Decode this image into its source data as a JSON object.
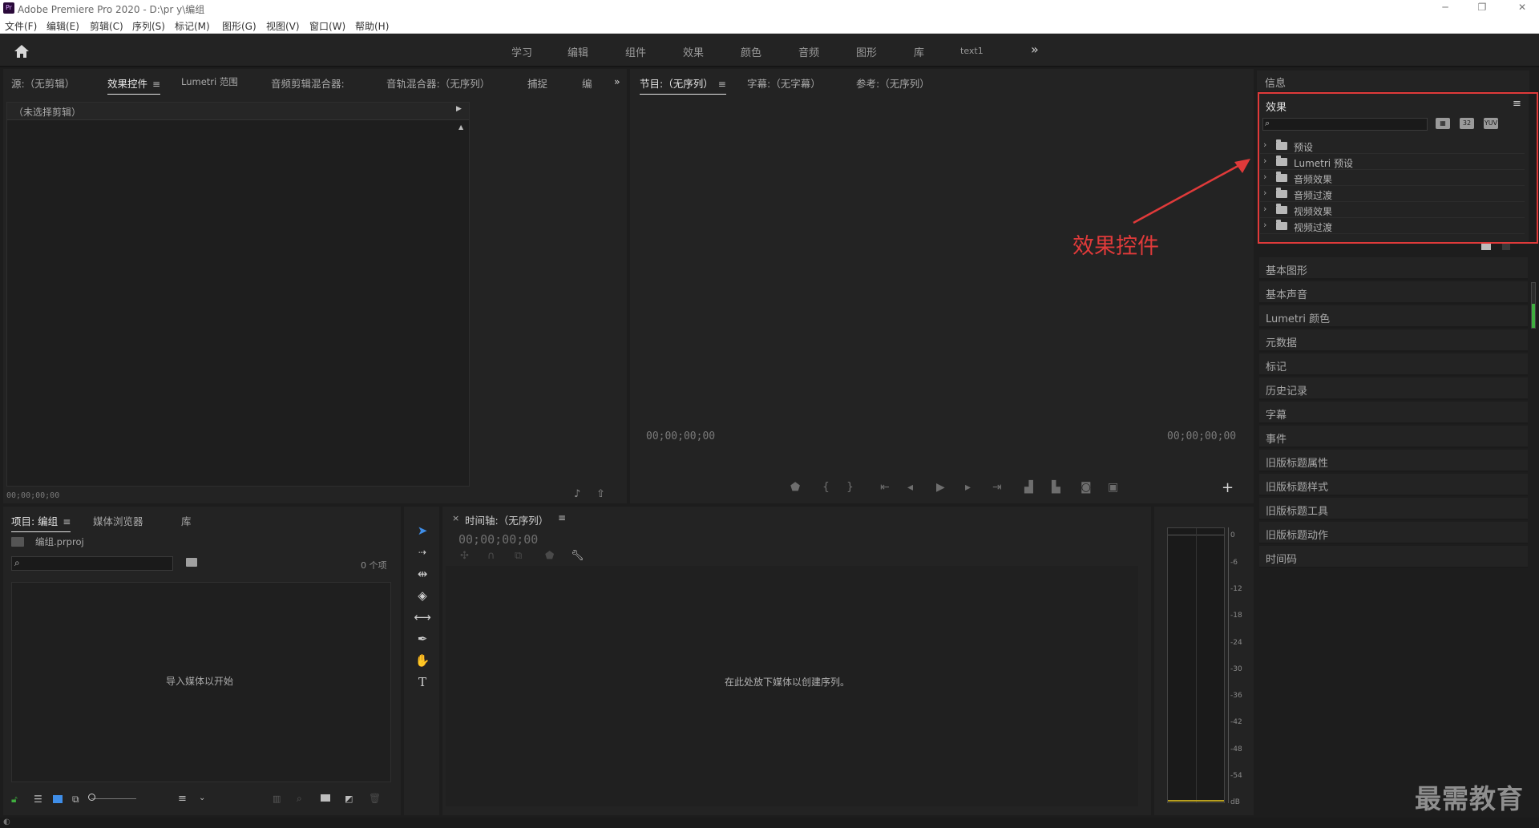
{
  "app": {
    "title": "Adobe Premiere Pro 2020 - D:\\pr y\\编组",
    "logo": "Pr"
  },
  "window_controls": {
    "minimize": "─",
    "restore": "❐",
    "close": "✕"
  },
  "menu": [
    "文件(F)",
    "编辑(E)",
    "剪辑(C)",
    "序列(S)",
    "标记(M)",
    "图形(G)",
    "视图(V)",
    "窗口(W)",
    "帮助(H)"
  ],
  "workspaces": [
    "学习",
    "编辑",
    "组件",
    "效果",
    "颜色",
    "音频",
    "图形",
    "库",
    "text1"
  ],
  "workspace_more": "»",
  "source_panel": {
    "tabs": [
      "源:（无剪辑）",
      "效果控件",
      "Lumetri 范围",
      "音频剪辑混合器:",
      "音轨混合器:（无序列）",
      "捕捉",
      "编"
    ],
    "active_tab": "效果控件",
    "more": "»",
    "header": "（未选择剪辑）",
    "timecode": "00;00;00;00"
  },
  "program_panel": {
    "tabs": [
      "节目:（无序列）",
      "字幕:（无字幕）",
      "参考:（无序列）"
    ],
    "active_tab": "节目:（无序列）",
    "timecode_left": "00;00;00;00",
    "timecode_right": "00;00;00;00",
    "add_button": "+"
  },
  "right_panel": {
    "info_tab": "信息",
    "effects": {
      "title": "效果",
      "search_placeholder": "",
      "items": [
        "预设",
        "Lumetri 预设",
        "音频效果",
        "音频过渡",
        "视频效果",
        "视频过渡"
      ]
    },
    "collapsed": [
      "基本图形",
      "基本声音",
      "Lumetri 颜色",
      "元数据",
      "标记",
      "历史记录",
      "字幕",
      "事件",
      "旧版标题属性",
      "旧版标题样式",
      "旧版标题工具",
      "旧版标题动作",
      "时间码"
    ]
  },
  "annotation": {
    "label": "效果控件",
    "color": "#e03a3a"
  },
  "project_panel": {
    "tabs": [
      "项目: 编组",
      "媒体浏览器",
      "库"
    ],
    "active_tab": "项目: 编组",
    "file": "编组.prproj",
    "count": "0 个项",
    "empty_text": "导入媒体以开始"
  },
  "timeline_panel": {
    "close": "×",
    "title": "时间轴:（无序列）",
    "timecode": "00;00;00;00",
    "empty_text": "在此处放下媒体以创建序列。"
  },
  "audio_meter": {
    "ticks": [
      "0",
      "-6",
      "-12",
      "-18",
      "-24",
      "-30",
      "-36",
      "-42",
      "-48",
      "-54",
      "dB"
    ]
  },
  "watermark": "最需教育",
  "colors": {
    "accent": "#3f8ee8",
    "highlight_box": "#e03a3a",
    "panel": "#232323",
    "background": "#1d1d1d"
  }
}
